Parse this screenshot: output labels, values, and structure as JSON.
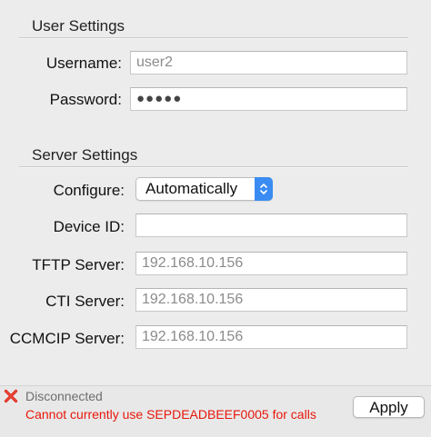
{
  "user_settings": {
    "title": "User Settings",
    "username_label": "Username:",
    "username_value": "user2",
    "password_label": "Password:",
    "password_value": "●●●●●"
  },
  "server_settings": {
    "title": "Server Settings",
    "configure_label": "Configure:",
    "configure_value": "Automatically",
    "device_id_label": "Device ID:",
    "device_id_value": "",
    "tftp_label": "TFTP Server:",
    "tftp_value": "192.168.10.156",
    "cti_label": "CTI Server:",
    "cti_value": "192.168.10.156",
    "ccmcip_label": "CCMCIP Server:",
    "ccmcip_value": "192.168.10.156"
  },
  "footer": {
    "status_icon": "x-error-icon",
    "status": "Disconnected",
    "error": "Cannot currently use SEPDEADBEEF0005 for calls",
    "apply_label": "Apply"
  },
  "colors": {
    "accent": "#3b8cf2",
    "error": "#e8170b",
    "error_icon": "#d9261c"
  }
}
